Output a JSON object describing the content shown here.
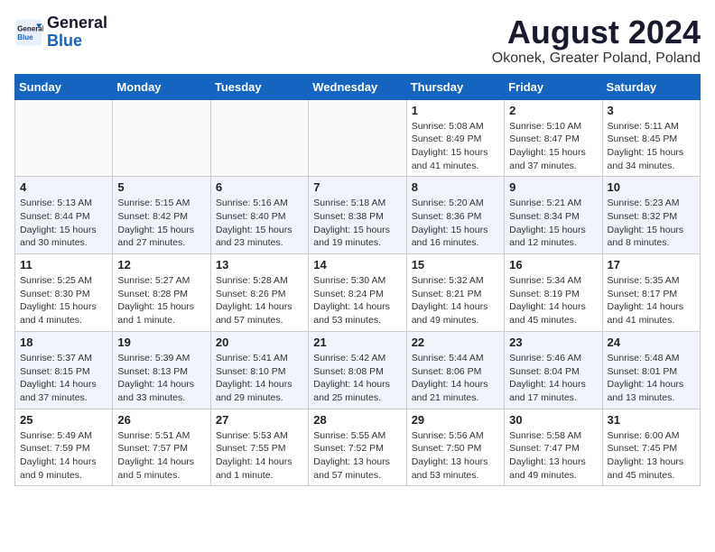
{
  "header": {
    "logo_line1": "General",
    "logo_line2": "Blue",
    "main_title": "August 2024",
    "subtitle": "Okonek, Greater Poland, Poland"
  },
  "days_of_week": [
    "Sunday",
    "Monday",
    "Tuesday",
    "Wednesday",
    "Thursday",
    "Friday",
    "Saturday"
  ],
  "weeks": [
    [
      {
        "day": "",
        "info": ""
      },
      {
        "day": "",
        "info": ""
      },
      {
        "day": "",
        "info": ""
      },
      {
        "day": "",
        "info": ""
      },
      {
        "day": "1",
        "info": "Sunrise: 5:08 AM\nSunset: 8:49 PM\nDaylight: 15 hours\nand 41 minutes."
      },
      {
        "day": "2",
        "info": "Sunrise: 5:10 AM\nSunset: 8:47 PM\nDaylight: 15 hours\nand 37 minutes."
      },
      {
        "day": "3",
        "info": "Sunrise: 5:11 AM\nSunset: 8:45 PM\nDaylight: 15 hours\nand 34 minutes."
      }
    ],
    [
      {
        "day": "4",
        "info": "Sunrise: 5:13 AM\nSunset: 8:44 PM\nDaylight: 15 hours\nand 30 minutes."
      },
      {
        "day": "5",
        "info": "Sunrise: 5:15 AM\nSunset: 8:42 PM\nDaylight: 15 hours\nand 27 minutes."
      },
      {
        "day": "6",
        "info": "Sunrise: 5:16 AM\nSunset: 8:40 PM\nDaylight: 15 hours\nand 23 minutes."
      },
      {
        "day": "7",
        "info": "Sunrise: 5:18 AM\nSunset: 8:38 PM\nDaylight: 15 hours\nand 19 minutes."
      },
      {
        "day": "8",
        "info": "Sunrise: 5:20 AM\nSunset: 8:36 PM\nDaylight: 15 hours\nand 16 minutes."
      },
      {
        "day": "9",
        "info": "Sunrise: 5:21 AM\nSunset: 8:34 PM\nDaylight: 15 hours\nand 12 minutes."
      },
      {
        "day": "10",
        "info": "Sunrise: 5:23 AM\nSunset: 8:32 PM\nDaylight: 15 hours\nand 8 minutes."
      }
    ],
    [
      {
        "day": "11",
        "info": "Sunrise: 5:25 AM\nSunset: 8:30 PM\nDaylight: 15 hours\nand 4 minutes."
      },
      {
        "day": "12",
        "info": "Sunrise: 5:27 AM\nSunset: 8:28 PM\nDaylight: 15 hours\nand 1 minute."
      },
      {
        "day": "13",
        "info": "Sunrise: 5:28 AM\nSunset: 8:26 PM\nDaylight: 14 hours\nand 57 minutes."
      },
      {
        "day": "14",
        "info": "Sunrise: 5:30 AM\nSunset: 8:24 PM\nDaylight: 14 hours\nand 53 minutes."
      },
      {
        "day": "15",
        "info": "Sunrise: 5:32 AM\nSunset: 8:21 PM\nDaylight: 14 hours\nand 49 minutes."
      },
      {
        "day": "16",
        "info": "Sunrise: 5:34 AM\nSunset: 8:19 PM\nDaylight: 14 hours\nand 45 minutes."
      },
      {
        "day": "17",
        "info": "Sunrise: 5:35 AM\nSunset: 8:17 PM\nDaylight: 14 hours\nand 41 minutes."
      }
    ],
    [
      {
        "day": "18",
        "info": "Sunrise: 5:37 AM\nSunset: 8:15 PM\nDaylight: 14 hours\nand 37 minutes."
      },
      {
        "day": "19",
        "info": "Sunrise: 5:39 AM\nSunset: 8:13 PM\nDaylight: 14 hours\nand 33 minutes."
      },
      {
        "day": "20",
        "info": "Sunrise: 5:41 AM\nSunset: 8:10 PM\nDaylight: 14 hours\nand 29 minutes."
      },
      {
        "day": "21",
        "info": "Sunrise: 5:42 AM\nSunset: 8:08 PM\nDaylight: 14 hours\nand 25 minutes."
      },
      {
        "day": "22",
        "info": "Sunrise: 5:44 AM\nSunset: 8:06 PM\nDaylight: 14 hours\nand 21 minutes."
      },
      {
        "day": "23",
        "info": "Sunrise: 5:46 AM\nSunset: 8:04 PM\nDaylight: 14 hours\nand 17 minutes."
      },
      {
        "day": "24",
        "info": "Sunrise: 5:48 AM\nSunset: 8:01 PM\nDaylight: 14 hours\nand 13 minutes."
      }
    ],
    [
      {
        "day": "25",
        "info": "Sunrise: 5:49 AM\nSunset: 7:59 PM\nDaylight: 14 hours\nand 9 minutes."
      },
      {
        "day": "26",
        "info": "Sunrise: 5:51 AM\nSunset: 7:57 PM\nDaylight: 14 hours\nand 5 minutes."
      },
      {
        "day": "27",
        "info": "Sunrise: 5:53 AM\nSunset: 7:55 PM\nDaylight: 14 hours\nand 1 minute."
      },
      {
        "day": "28",
        "info": "Sunrise: 5:55 AM\nSunset: 7:52 PM\nDaylight: 13 hours\nand 57 minutes."
      },
      {
        "day": "29",
        "info": "Sunrise: 5:56 AM\nSunset: 7:50 PM\nDaylight: 13 hours\nand 53 minutes."
      },
      {
        "day": "30",
        "info": "Sunrise: 5:58 AM\nSunset: 7:47 PM\nDaylight: 13 hours\nand 49 minutes."
      },
      {
        "day": "31",
        "info": "Sunrise: 6:00 AM\nSunset: 7:45 PM\nDaylight: 13 hours\nand 45 minutes."
      }
    ]
  ]
}
